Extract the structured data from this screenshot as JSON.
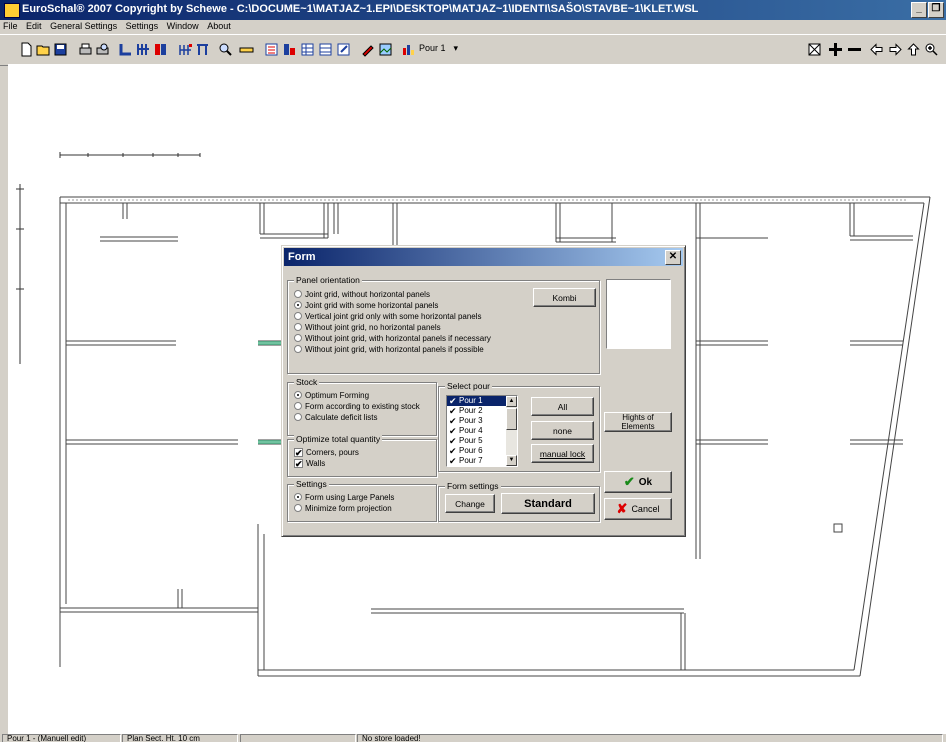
{
  "window": {
    "title": "EuroSchal® 2007 Copyright by Schewe  - C:\\DOCUME~1\\MATJAZ~1.EPI\\DESKTOP\\MATJAZ~1\\IDENTI\\SAŠO\\STAVBE~1\\KLET.WSL"
  },
  "menu": [
    "File",
    "Edit",
    "General Settings",
    "Settings",
    "Window",
    "About"
  ],
  "toolbar": {
    "pour_select": "Pour 1",
    "icons": [
      "new-file-icon",
      "open-folder-icon",
      "save-icon",
      "print-icon",
      "print-preview-icon",
      "corner-icon",
      "grid-panel-icon",
      "panel-color-icon",
      "panel-set-icon",
      "frame-icon",
      "search-icon",
      "measure-icon",
      "panel-list-icon",
      "panel-stack-icon",
      "table-icon",
      "table2-icon",
      "export-icon",
      "paint-icon",
      "image-icon",
      "chart-icon"
    ],
    "right_icons": [
      "fit-view-icon",
      "pan-icon",
      "horizontal-line-icon",
      "arrow-left-icon",
      "arrow-right-icon",
      "arrow-up-icon",
      "arrow-down-icon",
      "zoom-icon"
    ]
  },
  "dialog": {
    "title": "Form",
    "panel_orientation": {
      "legend": "Panel orientation",
      "options": [
        "Joint grid, without horizontal panels",
        "Joint grid with some horizontal panels",
        "Vertical joint grid only with some horizontal panels",
        "Without joint grid, no horizontal panels",
        "Without joint grid, with horizontal panels if necessary",
        "Without joint grid, with horizontal panels if possible"
      ],
      "selected": 1,
      "kombi_label": "Kombi"
    },
    "stock": {
      "legend": "Stock",
      "options": [
        "Optimum Forming",
        "Form according to existing stock",
        "Calculate deficit lists"
      ],
      "selected": 0
    },
    "optimize": {
      "legend": "Optimize total quantity",
      "items": [
        {
          "label": "Corners, pours",
          "checked": true
        },
        {
          "label": "Walls",
          "checked": true
        }
      ]
    },
    "settings": {
      "legend": "Settings",
      "options": [
        "Form using Large Panels",
        "Minimize form projection"
      ],
      "selected": 0
    },
    "select_pour": {
      "legend": "Select pour",
      "items": [
        "Pour 1",
        "Pour 2",
        "Pour 3",
        "Pour 4",
        "Pour 5",
        "Pour 6",
        "Pour 7"
      ],
      "all_label": "All",
      "none_label": "none",
      "manual_lock_label": "manual lock"
    },
    "form_settings": {
      "legend": "Form settings",
      "change_label": "Change",
      "value": "Standard"
    },
    "hights_label": "Hights of Elements",
    "ok_label": "Ok",
    "cancel_label": "Cancel",
    "check_mark": "✔",
    "x_mark": "✘"
  },
  "status": {
    "pour": "Pour 1 - (Manuell edit)",
    "plan": "Plan Sect. Ht. 10 cm",
    "empty": "",
    "store": "No store loaded!"
  }
}
